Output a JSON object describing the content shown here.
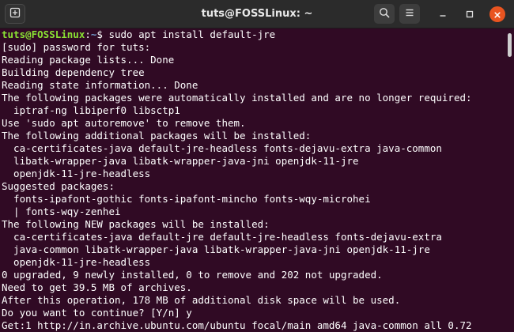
{
  "window": {
    "title": "tuts@FOSSLinux: ~"
  },
  "titlebar": {
    "new_tab_icon": "new-tab-icon",
    "search_icon": "search-icon",
    "menu_icon": "hamburger-menu-icon",
    "minimize_icon": "minimize-icon",
    "maximize_icon": "maximize-icon",
    "close_icon": "close-icon",
    "close_color": "#e95420"
  },
  "colors": {
    "background": "#300a24",
    "prompt_user": "#8ae234",
    "prompt_path": "#729fcf",
    "text": "#ffffff"
  },
  "terminal": {
    "prompt": {
      "user_host": "tuts@FOSSLinux",
      "separator": ":",
      "path": "~",
      "symbol": "$ ",
      "command": "sudo apt install default-jre"
    },
    "output": [
      "[sudo] password for tuts:",
      "Reading package lists... Done",
      "Building dependency tree",
      "Reading state information... Done",
      "The following packages were automatically installed and are no longer required:",
      "  iptraf-ng libiperf0 libsctp1",
      "Use 'sudo apt autoremove' to remove them.",
      "The following additional packages will be installed:",
      "  ca-certificates-java default-jre-headless fonts-dejavu-extra java-common",
      "  libatk-wrapper-java libatk-wrapper-java-jni openjdk-11-jre",
      "  openjdk-11-jre-headless",
      "Suggested packages:",
      "  fonts-ipafont-gothic fonts-ipafont-mincho fonts-wqy-microhei",
      "  | fonts-wqy-zenhei",
      "The following NEW packages will be installed:",
      "  ca-certificates-java default-jre default-jre-headless fonts-dejavu-extra",
      "  java-common libatk-wrapper-java libatk-wrapper-java-jni openjdk-11-jre",
      "  openjdk-11-jre-headless",
      "0 upgraded, 9 newly installed, 0 to remove and 202 not upgraded.",
      "Need to get 39.5 MB of archives.",
      "After this operation, 178 MB of additional disk space will be used.",
      "Do you want to continue? [Y/n] y",
      "Get:1 http://in.archive.ubuntu.com/ubuntu focal/main amd64 java-common all 0.72"
    ]
  }
}
